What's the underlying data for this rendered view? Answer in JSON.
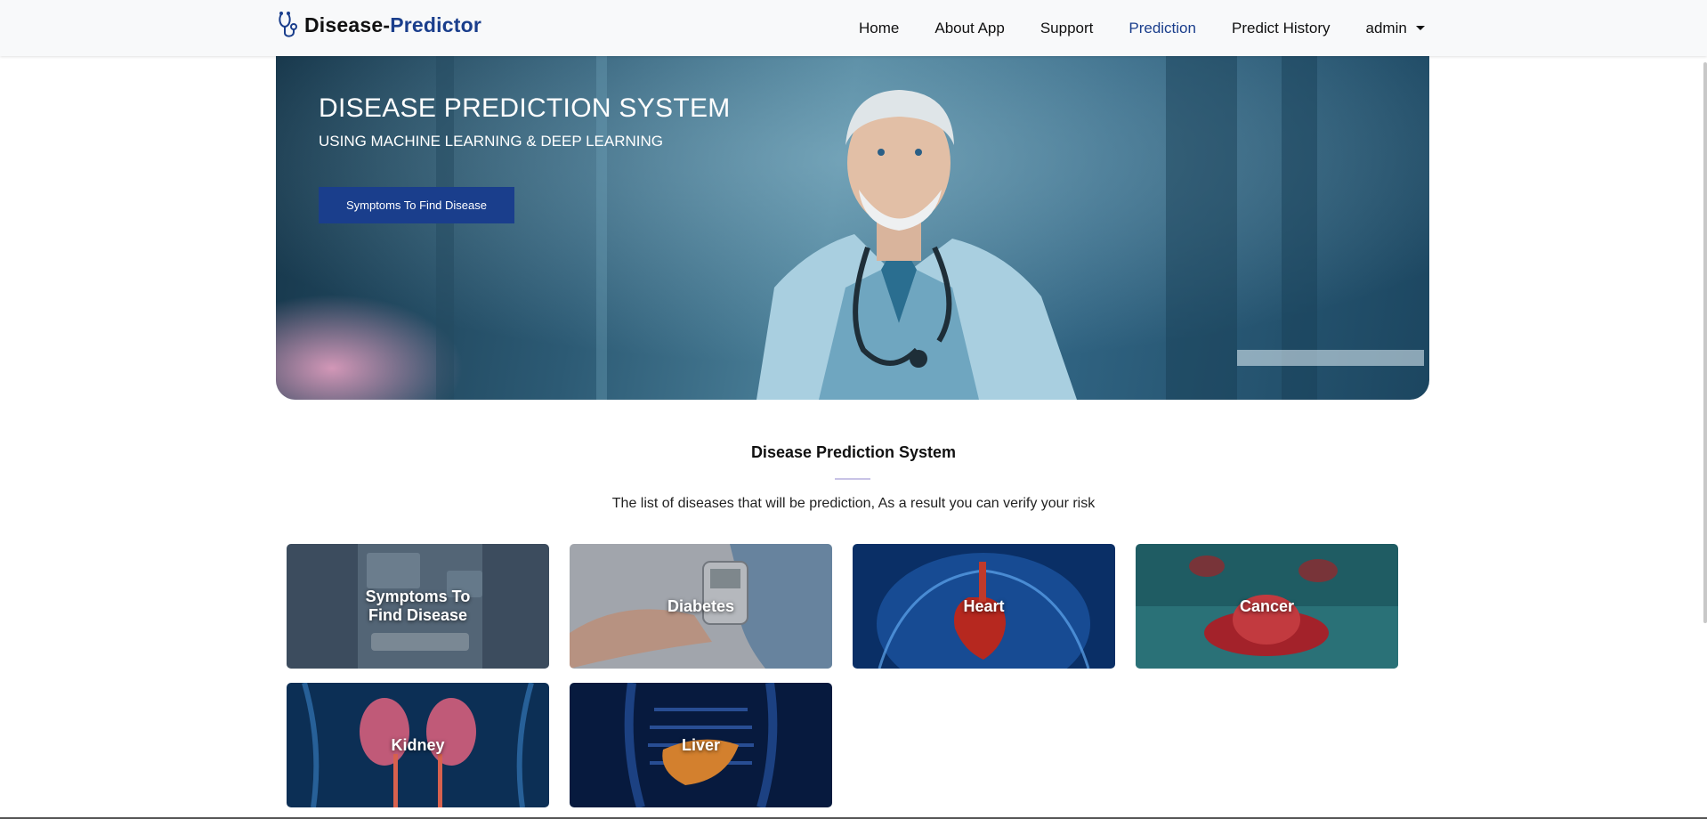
{
  "brand": {
    "part1": "Disease-",
    "part2": "Predictor"
  },
  "nav": {
    "home": "Home",
    "about": "About App",
    "support": "Support",
    "prediction": "Prediction",
    "history": "Predict History",
    "user": "admin"
  },
  "hero": {
    "title": "DISEASE PREDICTION SYSTEM",
    "subtitle": "USING MACHINE LEARNING & DEEP LEARNING",
    "button": "Symptoms To Find Disease"
  },
  "section": {
    "title": "Disease Prediction System",
    "description": "The list of diseases that will be prediction, As a result you can verify your risk"
  },
  "cards": [
    {
      "label": "Symptoms To Find Disease"
    },
    {
      "label": "Diabetes"
    },
    {
      "label": "Heart"
    },
    {
      "label": "Cancer"
    },
    {
      "label": "Kidney"
    },
    {
      "label": "Liver"
    }
  ],
  "colors": {
    "accent": "#1a3e8c",
    "navbar": "#f8f9fa"
  }
}
